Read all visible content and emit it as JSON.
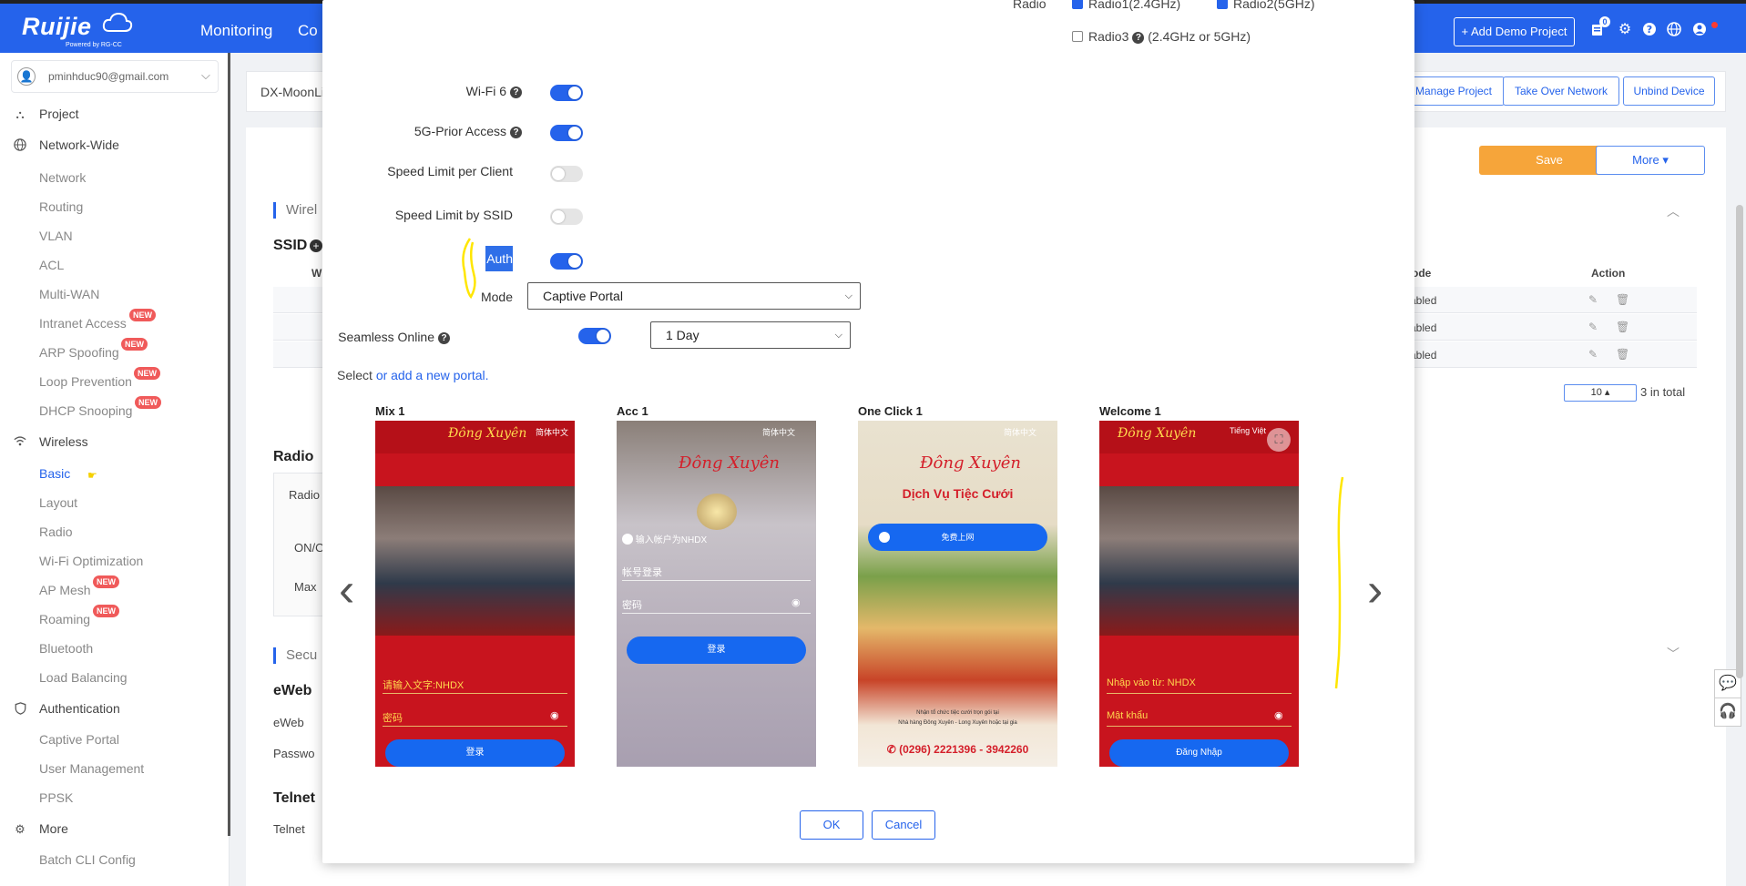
{
  "topbar": {
    "logo": "Ruijie",
    "logo_sub": "Powered by RG-CC",
    "nav": [
      "Monitoring",
      "Co"
    ],
    "add_demo_project": "+ Add Demo Project",
    "notification_count": "0"
  },
  "sidebar": {
    "user_email": "pminhduc90@gmail.com",
    "items": {
      "project": "Project",
      "network_wide": "Network-Wide",
      "network": "Network",
      "routing": "Routing",
      "vlan": "VLAN",
      "acl": "ACL",
      "multi_wan": "Multi-WAN",
      "intranet_access": "Intranet Access",
      "arp_spoofing": "ARP Spoofing",
      "loop_prevention": "Loop Prevention",
      "dhcp_snooping": "DHCP Snooping",
      "wireless": "Wireless",
      "basic": "Basic",
      "layout": "Layout",
      "radio": "Radio",
      "wifi_optimization": "Wi-Fi Optimization",
      "ap_mesh": "AP Mesh",
      "roaming": "Roaming",
      "bluetooth": "Bluetooth",
      "load_balancing": "Load Balancing",
      "authentication": "Authentication",
      "captive_portal": "Captive Portal",
      "user_management": "User Management",
      "ppsk": "PPSK",
      "more": "More",
      "batch_cli_config": "Batch CLI Config"
    },
    "new_badge": "NEW"
  },
  "background": {
    "project_name": "DX-MoonLi",
    "manage_project": "Manage Project",
    "take_over_network": "Take Over Network",
    "unbind_device": "Unbind Device",
    "save": "Save",
    "more": "More",
    "wireless_section": "Wirel",
    "ssid": "SSID",
    "w_col": "W",
    "mode_col": "Mode",
    "action_col": "Action",
    "rows": [
      "abled",
      "abled",
      "abled"
    ],
    "page_size": "10",
    "total": "3 in total",
    "radio_section": "Radio",
    "radio_tab": "Radio",
    "on_off": "ON/O",
    "max": "Max",
    "security_section": "Secu",
    "eweb_title": "eWeb",
    "eweb_label": "eWeb",
    "password_label": "Passwo",
    "telnet_title": "Telnet",
    "telnet_label": "Telnet"
  },
  "modal": {
    "radio_label": "Radio",
    "radio1": "Radio1(2.4GHz)",
    "radio2": "Radio2(5GHz)",
    "radio3": "Radio3",
    "radio3_note": "(2.4GHz or 5GHz)",
    "wifi6": "Wi-Fi 6",
    "prior_5g": "5G-Prior Access",
    "speed_limit_client": "Speed Limit per Client",
    "speed_limit_ssid": "Speed Limit by SSID",
    "auth": "Auth",
    "mode": "Mode",
    "mode_value": "Captive Portal",
    "seamless_online": "Seamless Online",
    "seamless_value": "1 Day",
    "select_text": "Select",
    "add_portal_link": "or add a new portal.",
    "portals": [
      {
        "title": "Mix 1",
        "lang": "简体中文",
        "input1": "请输入文字:NHDX",
        "input2": "密码",
        "button": "登录"
      },
      {
        "title": "Acc 1",
        "lang": "简体中文",
        "input1": "输入帐户为NHDX",
        "input2": "帐号登录",
        "input3": "密码",
        "button": "登录"
      },
      {
        "title": "One Click 1",
        "lang": "简体中文",
        "button": "免费上网",
        "banner": "Dịch Vụ Tiệc Cưới",
        "note1": "Nhận tổ chức tiệc cưới trọn gói tại",
        "note2": "Nhà hàng Đông Xuyên - Long Xuyên hoặc tại gia",
        "phone": "(0296) 2221396 - 3942260"
      },
      {
        "title": "Welcome 1",
        "lang": "Tiếng Việt",
        "input1": "Nhập vào từ: NHDX",
        "input2": "Mật khẩu",
        "button": "Đăng Nhập"
      }
    ],
    "brand_script": "Đông Xuyên",
    "ok": "OK",
    "cancel": "Cancel"
  },
  "colors": {
    "primary": "#2563eb",
    "save": "#f6a53a",
    "badge": "#f05a5a",
    "portal_red": "#c8141e",
    "highlight": "#ffe600"
  }
}
